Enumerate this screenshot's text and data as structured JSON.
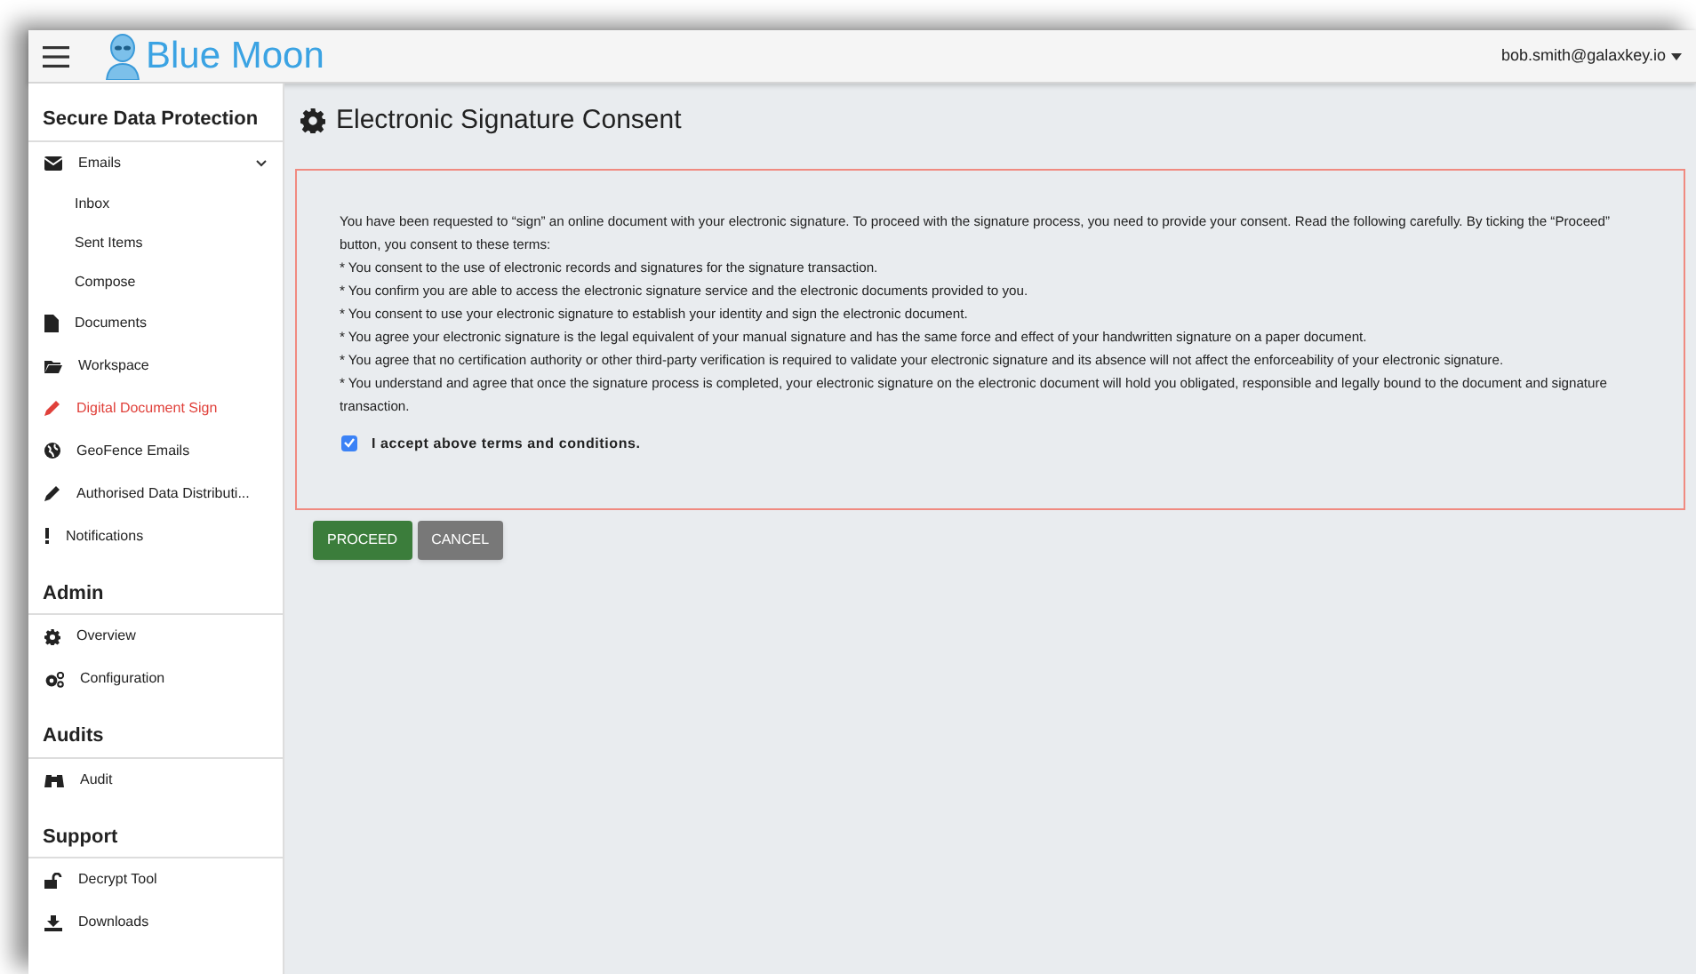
{
  "header": {
    "brand": "Blue Moon",
    "user": "bob.smith@galaxkey.io"
  },
  "sidebar": {
    "sections": [
      {
        "title": "Secure Data Protection",
        "items": [
          {
            "label": "Emails",
            "selected": false,
            "expanded": true,
            "children": [
              {
                "label": "Inbox",
                "selected": false
              },
              {
                "label": "Sent Items",
                "selected": false
              },
              {
                "label": "Compose",
                "selected": false
              }
            ]
          },
          {
            "label": "Documents",
            "selected": false
          },
          {
            "label": "Workspace",
            "selected": false
          },
          {
            "label": "Digital Document Sign",
            "selected": true
          },
          {
            "label": "GeoFence Emails",
            "selected": false
          },
          {
            "label": "Authorised Data Distributi...",
            "selected": false
          },
          {
            "label": "Notifications",
            "selected": false
          }
        ]
      },
      {
        "title": "Admin",
        "items": [
          {
            "label": "Overview",
            "selected": false
          },
          {
            "label": "Configuration",
            "selected": false
          }
        ]
      },
      {
        "title": "Audits",
        "items": [
          {
            "label": "Audit",
            "selected": false
          }
        ]
      },
      {
        "title": "Support",
        "items": [
          {
            "label": "Decrypt Tool",
            "selected": false
          },
          {
            "label": "Downloads",
            "selected": false
          }
        ]
      }
    ]
  },
  "page": {
    "title": "Electronic Signature Consent",
    "intro": "You have been requested to “sign” an online document with your electronic signature. To proceed with the signature process, you need to provide your consent. Read the following carefully. By ticking the “Proceed” button, you consent to these terms:",
    "terms": [
      "* You consent to the use of electronic records and signatures for the signature transaction.",
      "* You confirm you are able to access the electronic signature service and the electronic documents provided to you.",
      "* You consent to use your electronic signature to establish your identity and sign the electronic document.",
      "* You agree your electronic signature is the legal equivalent of your manual signature and has the same force and effect of your handwritten signature on a paper document.",
      "* You agree that no certification authority or other third-party verification is required to validate your electronic signature and its absence will not affect the enforceability of your electronic signature.",
      "* You understand and agree that once the signature process is completed, your electronic signature on the electronic document will hold you obligated, responsible and legally bound to the document and signature transaction."
    ],
    "accept": {
      "label": "I accept above terms and conditions.",
      "checked": true
    },
    "buttons": [
      {
        "label": "PROCEED",
        "kind": "primary"
      },
      {
        "label": "CANCEL",
        "kind": "secondary"
      }
    ]
  }
}
